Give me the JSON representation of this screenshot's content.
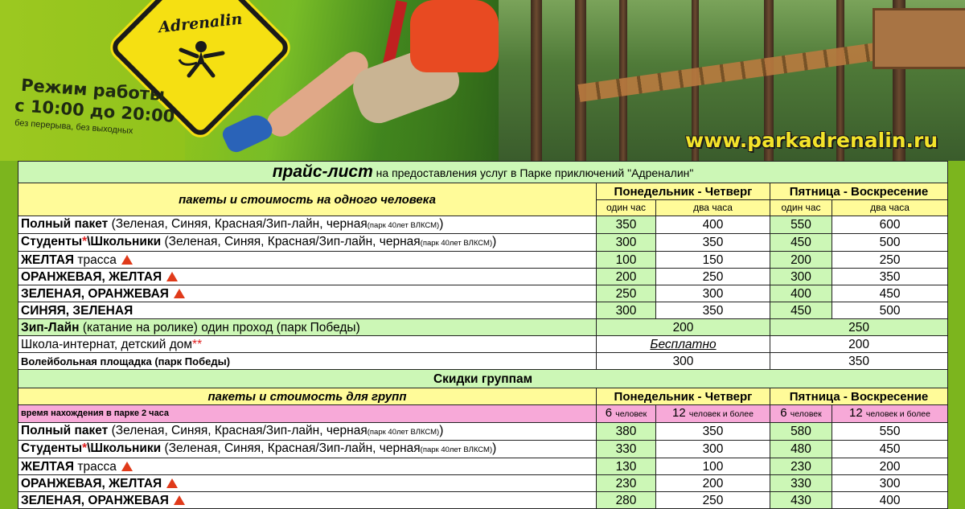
{
  "banner": {
    "logo_text": "Adrenalin",
    "hours_title": "Режим работы",
    "hours_time": "с 10:00 до 20:00",
    "hours_note": "без перерыва, без выходных",
    "website": "www.parkadrenalin.ru"
  },
  "table": {
    "title_main": "прайс-лист",
    "title_rest": "на предоставления услуг в Парке приключений \"Адреналин\"",
    "individual_header": "пакеты и стоимость на одного человека",
    "weekday": "Понедельник - Четверг",
    "weekend": "Пятница - Воскресение",
    "one_hour": "один час",
    "two_hours": "два часа",
    "individual_rows": [
      {
        "bold": "Полный пакет",
        "normal": " (Зеленая, Синяя, Красная/Зип-лайн, черная",
        "small": "(парк 40лет ВЛКСМ)",
        "tail": ")",
        "warn": false,
        "v": [
          "350",
          "400",
          "550",
          "600"
        ]
      },
      {
        "bold": "Студенты",
        "ast": "*",
        "bold2": "\\Школьники",
        "normal": " (Зеленая, Синяя, Красная/Зип-лайн, черная",
        "small": "(парк 40лет ВЛКСМ)",
        "tail": ")",
        "warn": false,
        "v": [
          "300",
          "350",
          "450",
          "500"
        ]
      },
      {
        "bold": "ЖЕЛТАЯ",
        "normal": " трасса",
        "warn": true,
        "v": [
          "100",
          "150",
          "200",
          "250"
        ]
      },
      {
        "bold": "ОРАНЖЕВАЯ, ЖЕЛТАЯ",
        "normal": "",
        "warn": true,
        "v": [
          "200",
          "250",
          "300",
          "350"
        ]
      },
      {
        "bold": "ЗЕЛЕНАЯ, ОРАНЖЕВАЯ",
        "normal": "",
        "warn": true,
        "v": [
          "250",
          "300",
          "400",
          "450"
        ]
      },
      {
        "bold": "СИНЯЯ, ЗЕЛЕНАЯ",
        "normal": "",
        "warn": false,
        "v": [
          "300",
          "350",
          "450",
          "500"
        ]
      }
    ],
    "zipline": {
      "bold": "Зип-Лайн",
      "normal": " (катание на ролике) один проход (парк Победы)",
      "weekday": "200",
      "weekend": "250"
    },
    "school": {
      "label": "Школа-интернат, детский дом",
      "ast": "**",
      "weekday": "Бесплатно",
      "weekend": "200"
    },
    "volley": {
      "label": "Волейбольная площадка (парк Победы)",
      "weekday": "300",
      "weekend": "350"
    },
    "group_title": "Скидки группам",
    "group_header": "пакеты и стоимость для групп",
    "group_time": "время нахождения в парке 2 часа",
    "six": "6",
    "six_label": "человек",
    "twelve": "12",
    "twelve_label": "человек и более",
    "group_rows": [
      {
        "bold": "Полный пакет",
        "normal": " (Зеленая, Синяя, Красная/Зип-лайн, черная",
        "small": "(парк 40лет ВЛКСМ)",
        "tail": ")",
        "warn": false,
        "v": [
          "380",
          "350",
          "580",
          "550"
        ]
      },
      {
        "bold": "Студенты",
        "ast": "*",
        "bold2": "\\Школьники",
        "normal": " (Зеленая, Синяя, Красная/Зип-лайн, черная",
        "small": "(парк 40лет ВЛКСМ)",
        "tail": ")",
        "warn": false,
        "v": [
          "330",
          "300",
          "480",
          "450"
        ]
      },
      {
        "bold": "ЖЕЛТАЯ",
        "normal": " трасса",
        "warn": true,
        "v": [
          "130",
          "100",
          "230",
          "200"
        ]
      },
      {
        "bold": "ОРАНЖЕВАЯ, ЖЕЛТАЯ",
        "normal": "",
        "warn": true,
        "v": [
          "230",
          "200",
          "330",
          "300"
        ]
      },
      {
        "bold": "ЗЕЛЕНАЯ, ОРАНЖЕВАЯ",
        "normal": "",
        "warn": true,
        "v": [
          "280",
          "250",
          "430",
          "400"
        ]
      }
    ]
  }
}
